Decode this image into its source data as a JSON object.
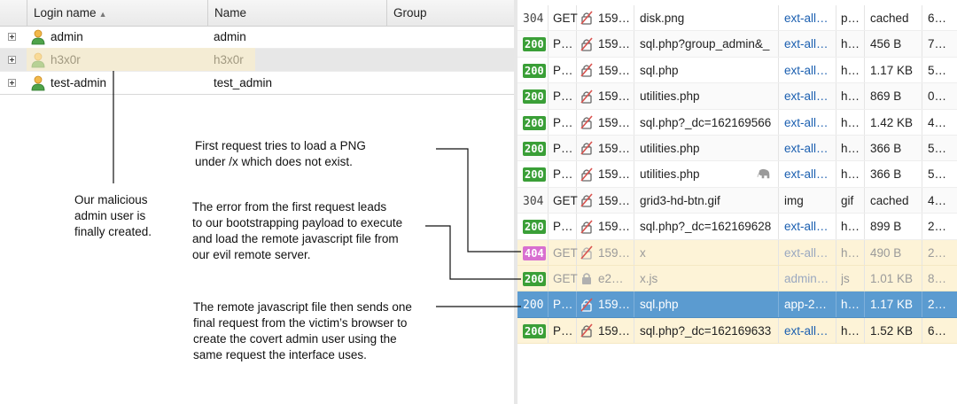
{
  "users_grid": {
    "columns": [
      {
        "label": "Login name"
      },
      {
        "label": "Name"
      },
      {
        "label": "Group"
      }
    ],
    "rows": [
      {
        "login": "admin",
        "name": "admin",
        "selected": false
      },
      {
        "login": "h3x0r",
        "name": "h3x0r",
        "selected": true
      },
      {
        "login": "test-admin",
        "name": "test_admin",
        "selected": false
      }
    ]
  },
  "network": {
    "rows": [
      {
        "status": "304",
        "method": "GET",
        "domain": "159…",
        "file": "disk.png",
        "initiator": "ext-all…",
        "type": "p…",
        "size": "cached",
        "time": "6…"
      },
      {
        "status": "200",
        "method": "P…",
        "domain": "159…",
        "file": "sql.php?group_admin&_",
        "initiator": "ext-all…",
        "type": "h…",
        "size": "456 B",
        "time": "7…"
      },
      {
        "status": "200",
        "method": "P…",
        "domain": "159…",
        "file": "sql.php",
        "initiator": "ext-all…",
        "type": "h…",
        "size": "1.17 KB",
        "time": "5…"
      },
      {
        "status": "200",
        "method": "P…",
        "domain": "159…",
        "file": "utilities.php",
        "initiator": "ext-all…",
        "type": "h…",
        "size": "869 B",
        "time": "0…"
      },
      {
        "status": "200",
        "method": "P…",
        "domain": "159…",
        "file": "sql.php?_dc=162169566",
        "initiator": "ext-all…",
        "type": "h…",
        "size": "1.42 KB",
        "time": "4…"
      },
      {
        "status": "200",
        "method": "P…",
        "domain": "159…",
        "file": "utilities.php",
        "initiator": "ext-all…",
        "type": "h…",
        "size": "366 B",
        "time": "5…"
      },
      {
        "status": "200",
        "method": "P…",
        "domain": "159…",
        "file": "utilities.php",
        "initiator": "ext-all…",
        "type": "h…",
        "size": "366 B",
        "time": "5…"
      },
      {
        "status": "304",
        "method": "GET",
        "domain": "159…",
        "file": "grid3-hd-btn.gif",
        "initiator": "img",
        "type": "gif",
        "size": "cached",
        "time": "4…"
      },
      {
        "status": "200",
        "method": "P…",
        "domain": "159…",
        "file": "sql.php?_dc=162169628",
        "initiator": "ext-all…",
        "type": "h…",
        "size": "899 B",
        "time": "2…"
      },
      {
        "status": "404",
        "method": "GET",
        "domain": "159…",
        "file": "x",
        "initiator": "ext-all…",
        "type": "h…",
        "size": "490 B",
        "time": "2…"
      },
      {
        "status": "200",
        "method": "GET",
        "domain": "e2…",
        "file": "x.js",
        "initiator": "admin…",
        "type": "js",
        "size": "1.01 KB",
        "time": "8…"
      },
      {
        "status": "200",
        "method": "P…",
        "domain": "159…",
        "file": "sql.php",
        "initiator": "app-2…",
        "type": "h…",
        "size": "1.17 KB",
        "time": "2…"
      },
      {
        "status": "200",
        "method": "P…",
        "domain": "159…",
        "file": "sql.php?_dc=162169633",
        "initiator": "ext-all…",
        "type": "h…",
        "size": "1.52 KB",
        "time": "6…"
      }
    ]
  },
  "annotations": {
    "user_note": [
      "Our malicious",
      "admin user is",
      "finally created."
    ],
    "png_note": [
      "First request tries to load a PNG",
      "under /x which does not exist."
    ],
    "error_note": [
      "The error from the first request leads",
      "to our bootstrapping payload to execute",
      "and load the remote javascript file from",
      "our evil remote server."
    ],
    "remote_note": [
      "The remote javascript file then sends one",
      "final request from the victim’s browser to",
      "create the covert admin user using the",
      "same request the interface uses."
    ]
  },
  "colors": {
    "status_ok": "#3a9f37",
    "status_not_found": "#d86fd0",
    "selected_row": "#5b9bd0",
    "highlight_row": "#fdf3d7",
    "link": "#1b5fb0"
  }
}
